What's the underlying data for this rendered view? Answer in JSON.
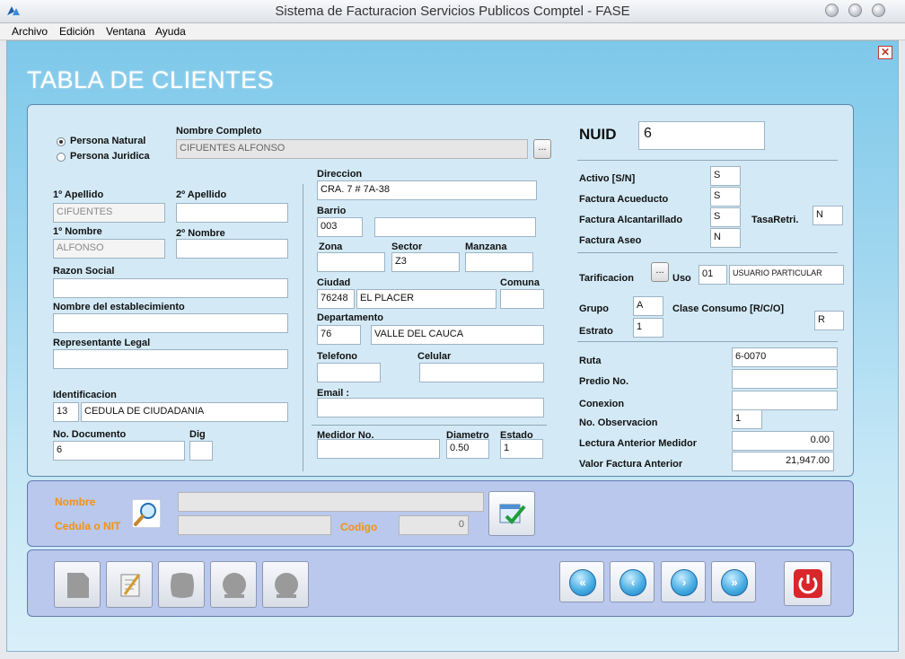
{
  "window": {
    "title": "Sistema de Facturacion Servicios Publicos Comptel - FASE"
  },
  "menu": [
    "Archivo",
    "Edición",
    "Ventana",
    "Ayuda"
  ],
  "page_title": "TABLA DE CLIENTES",
  "colors": {
    "accent_orange": "#f39211",
    "panel": "#d3eaf6",
    "frame_blue": "#7ec8ea"
  },
  "persona": {
    "natural": "Persona Natural",
    "juridica": "Persona Juridica"
  },
  "form": {
    "nombre_completo": {
      "label": "Nombre Completo",
      "value": "CIFUENTES  ALFONSO"
    },
    "browse_button": "...",
    "apellido1": {
      "label": "1º Apellido",
      "value": "CIFUENTES"
    },
    "apellido2": {
      "label": "2º Apellido",
      "value": ""
    },
    "nombre1": {
      "label": "1º Nombre",
      "value": "ALFONSO"
    },
    "nombre2": {
      "label": "2º Nombre",
      "value": ""
    },
    "razon_social": {
      "label": "Razon Social",
      "value": ""
    },
    "establecimiento": {
      "label": "Nombre del establecimiento",
      "value": ""
    },
    "representante": {
      "label": "Representante Legal",
      "value": ""
    },
    "identificacion": {
      "label": "Identificacion",
      "code": "13",
      "value": "CEDULA DE CIUDADANIA"
    },
    "documento": {
      "label": "No. Documento",
      "value": "6"
    },
    "dig": {
      "label": "Dig",
      "value": ""
    },
    "direccion": {
      "label": "Direccion",
      "value": "CRA. 7 # 7A-38"
    },
    "barrio": {
      "label": "Barrio",
      "code": "003",
      "value": ""
    },
    "zona": {
      "label": "Zona",
      "value": ""
    },
    "sector": {
      "label": "Sector",
      "value": "Z3"
    },
    "manzana": {
      "label": "Manzana",
      "value": ""
    },
    "ciudad": {
      "label": "Ciudad",
      "code": "76248",
      "value": "EL PLACER"
    },
    "comuna": {
      "label": "Comuna",
      "value": ""
    },
    "departamento": {
      "label": "Departamento",
      "code": "76",
      "value": "VALLE DEL CAUCA"
    },
    "telefono": {
      "label": "Telefono",
      "value": ""
    },
    "celular": {
      "label": "Celular",
      "value": ""
    },
    "email": {
      "label": "Email :",
      "value": ""
    },
    "medidor": {
      "label": "Medidor No.",
      "value": ""
    },
    "diametro": {
      "label": "Diametro",
      "value": "0.50"
    },
    "estado": {
      "label": "Estado",
      "value": "1"
    }
  },
  "right": {
    "nuid": {
      "label": "NUID",
      "value": "6"
    },
    "activo": {
      "label": "Activo [S/N]",
      "value": "S"
    },
    "acueducto": {
      "label": "Factura Acueducto",
      "value": "S"
    },
    "alcantarillado": {
      "label": "Factura Alcantarillado",
      "value": "S"
    },
    "tasa": {
      "label": "TasaRetri.",
      "value": "N"
    },
    "aseo": {
      "label": "Factura Aseo",
      "value": "N"
    },
    "tarificacion": {
      "label": "Tarificacion",
      "button": "..."
    },
    "uso": {
      "label": "Uso",
      "code": "01",
      "value": "USUARIO PARTICULAR"
    },
    "grupo": {
      "label": "Grupo",
      "value": "A"
    },
    "clase": {
      "label": "Clase Consumo [R/C/O]",
      "value": "R"
    },
    "estrato": {
      "label": "Estrato",
      "value": "1"
    },
    "ruta": {
      "label": "Ruta",
      "value": "6-0070"
    },
    "predio": {
      "label": "Predio No.",
      "value": ""
    },
    "conexion": {
      "label": "Conexion",
      "value": ""
    },
    "observacion": {
      "label": "No. Observacion",
      "value": "1"
    },
    "lectura": {
      "label": "Lectura Anterior Medidor",
      "value": "0.00"
    },
    "valor": {
      "label": "Valor Factura Anterior",
      "value": "21,947.00"
    }
  },
  "search": {
    "nombre_label": "Nombre",
    "cedula_label": "Cedula o NIT",
    "codigo_label": "Codigo",
    "nombre_value": "",
    "cedula_value": "",
    "codigo_value": "0"
  },
  "toolbar": {
    "icons": [
      "new-icon",
      "edit-icon",
      "save-icon",
      "delete-icon",
      "cancel-icon"
    ],
    "nav": [
      "first-icon",
      "prev-icon",
      "next-icon",
      "last-icon",
      "power-icon"
    ]
  }
}
